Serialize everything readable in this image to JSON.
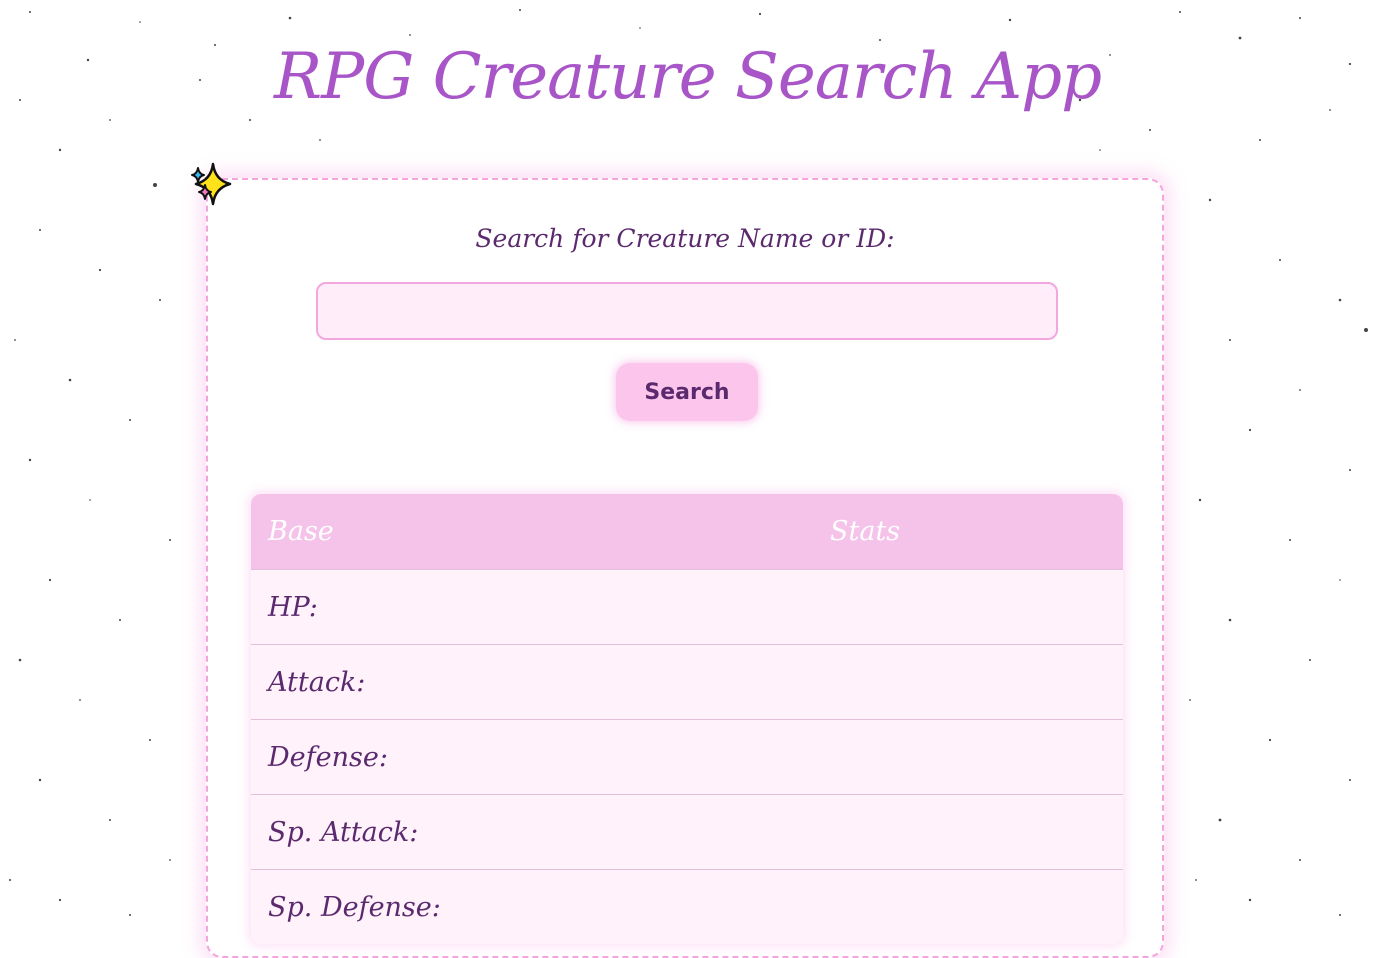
{
  "app": {
    "title": "RPG Creature Search App"
  },
  "search": {
    "label": "Search for Creature Name or ID:",
    "input_value": "",
    "button_label": "Search"
  },
  "stats_table": {
    "headers": [
      "Base",
      "Stats"
    ],
    "rows": [
      {
        "label": "HP:",
        "value": ""
      },
      {
        "label": "Attack:",
        "value": ""
      },
      {
        "label": "Defense:",
        "value": ""
      },
      {
        "label": "Sp. Attack:",
        "value": ""
      },
      {
        "label": "Sp. Defense:",
        "value": ""
      }
    ]
  },
  "colors": {
    "title": "#a855c8",
    "text": "#5b2a6e",
    "border": "#f4a6dc",
    "header_bg": "#f5c3ea",
    "button_bg": "#fcc6ec",
    "input_bg": "#ffeef9"
  },
  "icons": {
    "decoration": "sparkles-icon"
  }
}
